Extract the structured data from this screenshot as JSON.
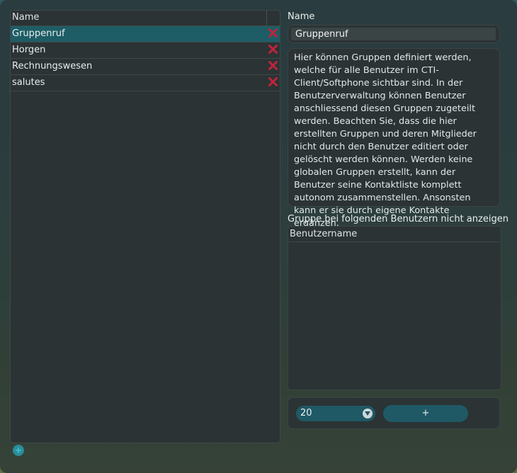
{
  "group_list": {
    "header": "Name",
    "rows": [
      {
        "name": "Gruppenruf",
        "selected": true
      },
      {
        "name": "Horgen",
        "selected": false
      },
      {
        "name": "Rechnungswesen",
        "selected": false
      },
      {
        "name": "salutes",
        "selected": false
      }
    ]
  },
  "detail": {
    "name_label": "Name",
    "name_value": "Gruppenruf",
    "description": "Hier können Gruppen definiert werden, welche für alle Benutzer im CTI-Client/Softphone sichtbar sind. In der Benutzerverwaltung können Benutzer anschliessend diesen Gruppen zugeteilt werden. Beachten Sie, dass die hier erstellten Gruppen und deren Mitglieder nicht durch den Benutzer editiert oder gelöscht werden können. Werden keine globalen Gruppen erstellt, kann der Benutzer seine Kontaktliste komplett autonom zusammenstellen. Ansonsten kann er sie durch eigene Kontakte ergänzen.",
    "hide_label": "Gruppe bei folgenden Benutzern nicht anzeigen",
    "user_table_header": "Benutzername",
    "select_value": "20",
    "add_button_label": "+"
  },
  "icons": {
    "delete": "close-x-icon",
    "add": "plus-circle-icon",
    "dropdown": "chevron-down-icon"
  },
  "colors": {
    "selected_row": "#1e5d66",
    "delete_icon": "#c0243a",
    "accent": "#1f5965"
  }
}
